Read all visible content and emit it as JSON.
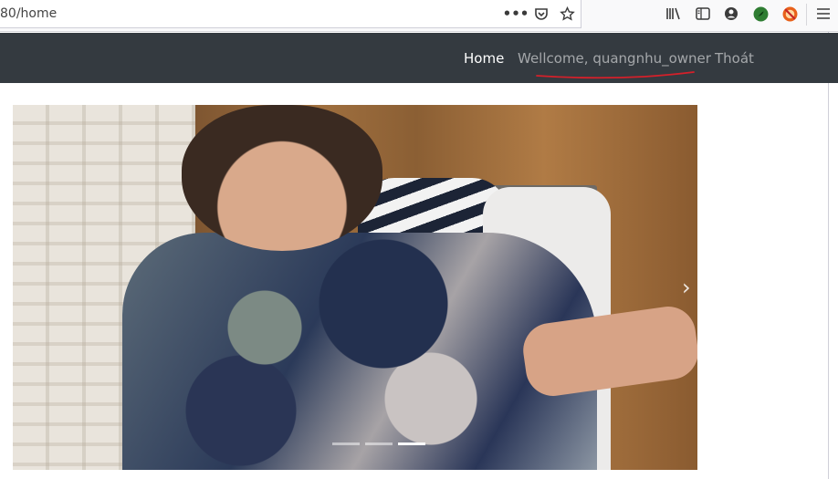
{
  "browser": {
    "url": "80/home",
    "icons": [
      "more-actions-icon",
      "pocket-icon",
      "bookmark-star-icon",
      "library-icon",
      "sidebar-icon",
      "account-icon",
      "extension-green-icon",
      "extension-orange-icon",
      "menu-icon"
    ]
  },
  "navbar": {
    "bg_color": "#343a40",
    "links": [
      {
        "label": "Home",
        "active": true
      },
      {
        "label": "Wellcome, quangnhu_owner",
        "active": false
      },
      {
        "label": "Thoát",
        "active": false
      }
    ]
  },
  "carousel": {
    "slide_count": 3,
    "active_index": 2,
    "next_glyph": "›"
  }
}
